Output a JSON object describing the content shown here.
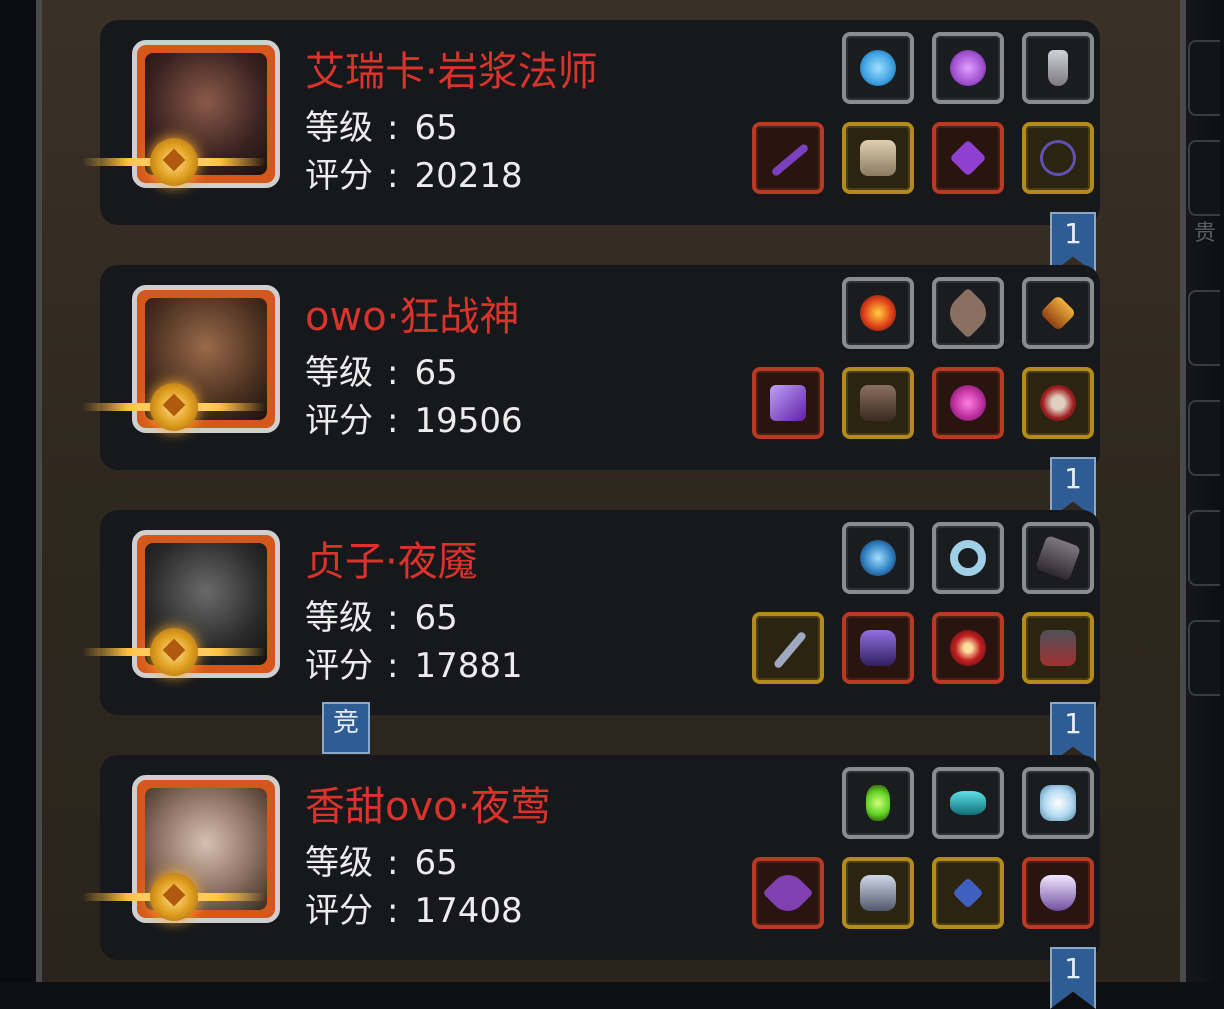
{
  "players": [
    {
      "name": "艾瑞卡·岩浆法师",
      "level_label": "等级",
      "level_value": "65",
      "score_label": "评分",
      "score_value": "20218",
      "rank_badge": "1",
      "equipment_top": [
        {
          "icon": "blue-orb-icon",
          "frame": "gray",
          "color": "#3ba0e0"
        },
        {
          "icon": "purple-crystal-icon",
          "frame": "gray",
          "color": "#a050d0"
        },
        {
          "icon": "potion-bottle-icon",
          "frame": "gray",
          "color": "#9a9aa0"
        }
      ],
      "equipment_bottom": [
        {
          "icon": "staff-icon",
          "frame": "red",
          "color": "#7a40c0"
        },
        {
          "icon": "robe-icon",
          "frame": "gold",
          "color": "#c8b890"
        },
        {
          "icon": "amulet-icon",
          "frame": "red",
          "color": "#9040d0"
        },
        {
          "icon": "pentagram-necklace-icon",
          "frame": "gold",
          "color": "#6050b0"
        }
      ]
    },
    {
      "name": "owo·狂战神",
      "level_label": "等级",
      "level_value": "65",
      "score_label": "评分",
      "score_value": "19506",
      "rank_badge": "1",
      "equipment_top": [
        {
          "icon": "fire-orb-icon",
          "frame": "gray",
          "color": "#e04018"
        },
        {
          "icon": "feather-icon",
          "frame": "gray",
          "color": "#8a7060"
        },
        {
          "icon": "lantern-icon",
          "frame": "gray",
          "color": "#d08020"
        }
      ],
      "equipment_bottom": [
        {
          "icon": "axe-icon",
          "frame": "red",
          "color": "#8040c0"
        },
        {
          "icon": "leather-armor-icon",
          "frame": "gold",
          "color": "#6a5040"
        },
        {
          "icon": "magic-helm-icon",
          "frame": "red",
          "color": "#c030a0"
        },
        {
          "icon": "skull-shield-icon",
          "frame": "gold",
          "color": "#a02020"
        }
      ]
    },
    {
      "name": "贞子·夜魇",
      "level_label": "等级",
      "level_value": "65",
      "score_label": "评分",
      "score_value": "17881",
      "rank_badge": "1",
      "equipment_top": [
        {
          "icon": "swirl-orb-icon",
          "frame": "gray",
          "color": "#3080c0"
        },
        {
          "icon": "ice-ring-icon",
          "frame": "gray",
          "color": "#a0d0e8"
        },
        {
          "icon": "dark-relic-icon",
          "frame": "gray",
          "color": "#504850"
        }
      ],
      "equipment_bottom": [
        {
          "icon": "dagger-icon",
          "frame": "gold",
          "color": "#7080a0"
        },
        {
          "icon": "purple-armor-icon",
          "frame": "red",
          "color": "#6040b0"
        },
        {
          "icon": "red-eye-gem-icon",
          "frame": "red",
          "color": "#c02020"
        },
        {
          "icon": "gauntlet-icon",
          "frame": "gold",
          "color": "#a03030"
        }
      ]
    },
    {
      "name": "香甜ovo·夜莺",
      "level_label": "等级",
      "level_value": "65",
      "score_label": "评分",
      "score_value": "17408",
      "rank_badge": "1",
      "equipment_top": [
        {
          "icon": "green-crystal-icon",
          "frame": "gray",
          "color": "#60d020"
        },
        {
          "icon": "teal-stone-icon",
          "frame": "gray",
          "color": "#20a0a8"
        },
        {
          "icon": "frost-rock-icon",
          "frame": "gray",
          "color": "#b0d8f0"
        }
      ],
      "equipment_bottom": [
        {
          "icon": "curved-blade-icon",
          "frame": "red",
          "color": "#8040b0"
        },
        {
          "icon": "steel-armor-icon",
          "frame": "gold",
          "color": "#9098a8"
        },
        {
          "icon": "pendant-icon",
          "frame": "gold",
          "color": "#4060c0"
        },
        {
          "icon": "demon-mask-icon",
          "frame": "red",
          "color": "#c0b0d0"
        }
      ]
    }
  ],
  "compete_badge": "竞",
  "side_tab_label": "贵"
}
